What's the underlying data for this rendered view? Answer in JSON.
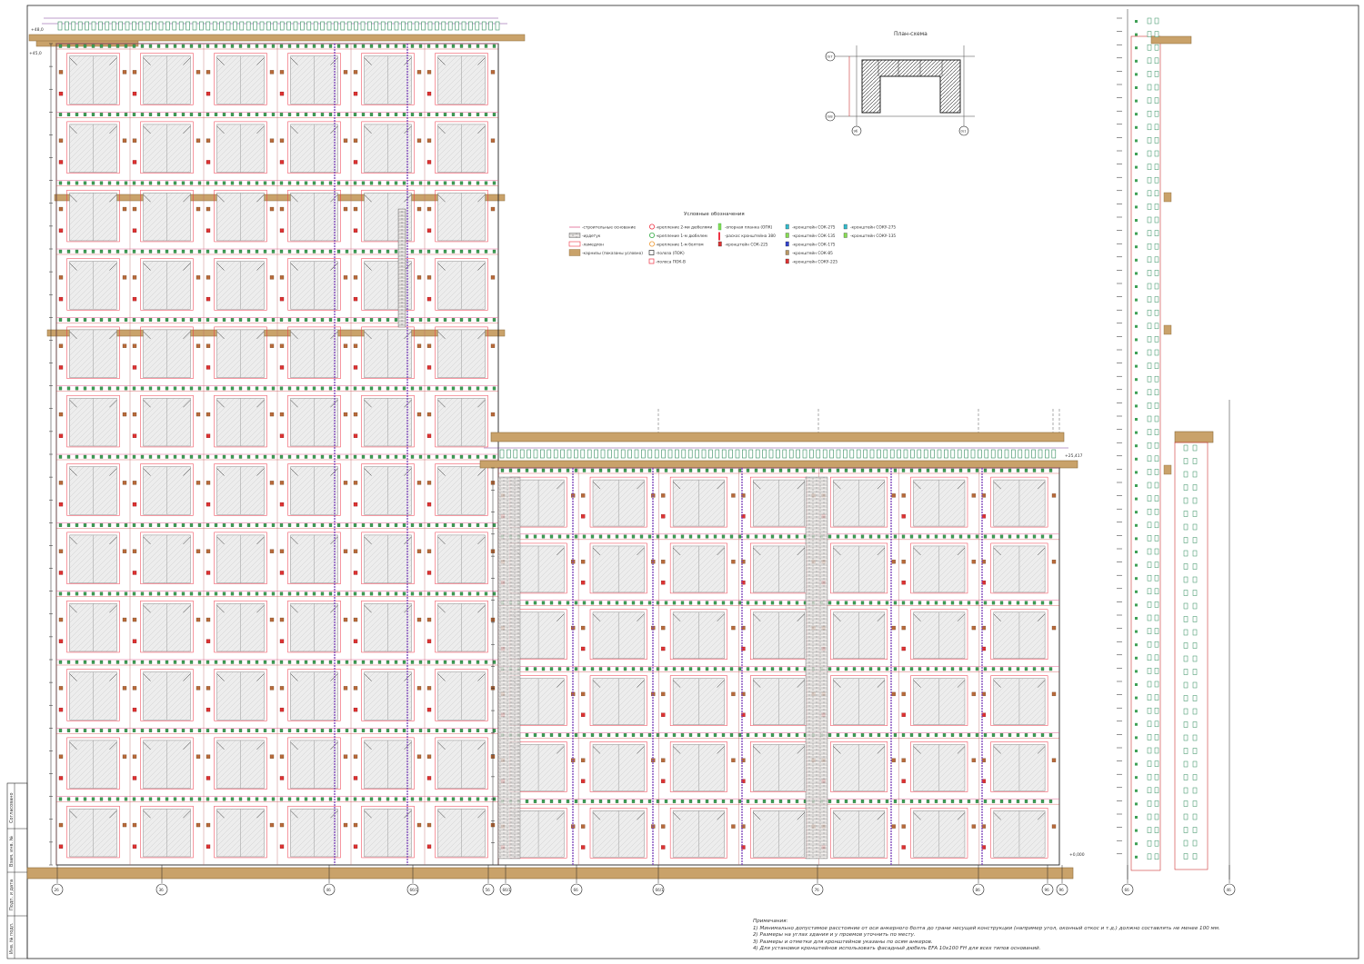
{
  "plan": {
    "title": "План-схема",
    "axis_left_top": "0/7",
    "axis_left_bottom": "0/8",
    "axis_bottom_left": "9б",
    "axis_bottom_right": "0/1"
  },
  "legend": {
    "title": "Условные обозначения",
    "items": [
      {
        "label": "-строительные основание",
        "sym": "line-pink",
        "col": 0
      },
      {
        "label": "-ирдетук",
        "sym": "brick",
        "col": 0
      },
      {
        "label": "-ламедлон",
        "sym": "rect-red",
        "col": 0
      },
      {
        "label": "-карнизы (показаны условно)",
        "sym": "cornice",
        "col": 0
      },
      {
        "label": "-крепление 2-ми дюбелями",
        "sym": "circle-red",
        "col": 1
      },
      {
        "label": "-крепление 1-м дюбелем",
        "sym": "circle-green",
        "col": 1
      },
      {
        "label": "-крепление 1-м болтом",
        "sym": "circle-orange",
        "col": 1
      },
      {
        "label": "-полоза (ПОК)",
        "sym": "square-dark",
        "col": 1
      },
      {
        "label": "-полоса ПОК-В",
        "sym": "square-red",
        "col": 1
      },
      {
        "label": "-опорная планка (ОПК)",
        "sym": "bar-green",
        "col": 2
      },
      {
        "label": "-раскос кронштейна 380",
        "sym": "bar-red",
        "col": 2
      },
      {
        "label": "-кронштейн СОК-225",
        "sym": "br-red",
        "col": 2
      },
      {
        "label": "-кронштейн СОК-275",
        "sym": "br-cyan",
        "col": 3
      },
      {
        "label": "-кронштейн СОК-135",
        "sym": "br-lime",
        "col": 3
      },
      {
        "label": "-кронштейн СОК-175",
        "sym": "br-blue",
        "col": 3
      },
      {
        "label": "-кронштейн СОК-85",
        "sym": "br-tan",
        "col": 3
      },
      {
        "label": "-кронштейн СОКУ-225",
        "sym": "br-red",
        "col": 3
      },
      {
        "label": "-кронштейн СОКУ-275",
        "sym": "br-cyan",
        "col": 4
      },
      {
        "label": "-кронштейн СОКУ-135",
        "sym": "br-lime",
        "col": 4
      }
    ]
  },
  "axes_bottom": [
    "2б",
    "3б",
    "4б",
    "6б/1",
    "5б",
    "6б/1",
    "6б",
    "6б/1",
    "7б",
    "8б",
    "9б",
    "9б",
    "6б",
    "4б"
  ],
  "level_marks": {
    "top_left": "+48,0",
    "left_mid": "+45,0",
    "right_roof": "+25,417",
    "bottom_right": "+0,000"
  },
  "notes": {
    "heading": "Примечания:",
    "lines": [
      "1) Минимально допустимое расстояние от оси анкерного болта до грани несущей конструкции (например угол, оконный откос и т.д.) должно составлять не менее 100 мм.",
      "2) Размеры на углах здания и у проемов уточнить по месту.",
      "3) Размеры и отметки для кронштейнов указаны по осям анкеров.",
      "4) Для установки кронштейнов использовать фасадный дюбель EFA 10х100 FH для всех типов оснований."
    ]
  },
  "title_block": {
    "labels": [
      "Инв. № подл.",
      "Подп. и дата",
      "Взам. инв. №",
      "Согласовано"
    ]
  }
}
